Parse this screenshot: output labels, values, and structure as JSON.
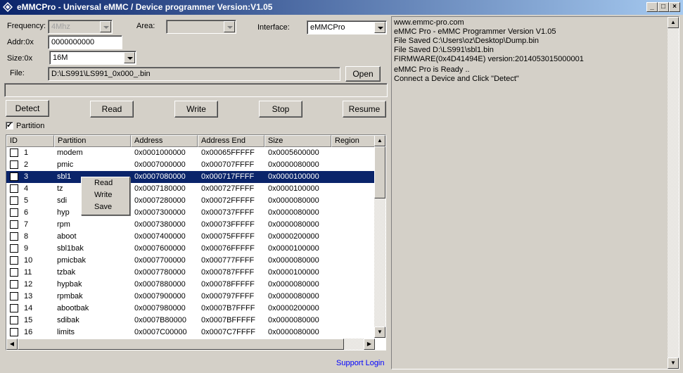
{
  "window": {
    "title": "eMMCPro - Universal eMMC / Device programmer  Version:V1.05"
  },
  "form": {
    "frequency_label": "Frequency:",
    "frequency_value": "4Mhz",
    "area_label": "Area:",
    "area_value": "",
    "interface_label": "Interface:",
    "interface_value": "eMMCPro",
    "addr_label": "Addr:0x",
    "addr_value": "0000000000",
    "size_label": "Size:0x",
    "size_value": "16M",
    "file_label": "File:",
    "file_value": "D:\\LS991\\LS991_0x000_.bin",
    "open_label": "Open"
  },
  "actions": {
    "detect": "Detect",
    "read": "Read",
    "write": "Write",
    "stop": "Stop",
    "resume": "Resume"
  },
  "partition_toggle": {
    "label": "Partition",
    "checked": true
  },
  "table": {
    "columns": [
      "ID",
      "Partition",
      "Address",
      "Address End",
      "Size",
      "Region"
    ],
    "rows": [
      {
        "id": "1",
        "name": "modem",
        "addr": "0x0001000000",
        "end": "0x00065FFFFF",
        "size": "0x0005600000"
      },
      {
        "id": "2",
        "name": "pmic",
        "addr": "0x0007000000",
        "end": "0x000707FFFF",
        "size": "0x0000080000"
      },
      {
        "id": "3",
        "name": "sbl1",
        "addr": "0x0007080000",
        "end": "0x000717FFFF",
        "size": "0x0000100000"
      },
      {
        "id": "4",
        "name": "tz",
        "addr": "0x0007180000",
        "end": "0x000727FFFF",
        "size": "0x0000100000"
      },
      {
        "id": "5",
        "name": "sdi",
        "addr": "0x0007280000",
        "end": "0x00072FFFFF",
        "size": "0x0000080000"
      },
      {
        "id": "6",
        "name": "hyp",
        "addr": "0x0007300000",
        "end": "0x000737FFFF",
        "size": "0x0000080000"
      },
      {
        "id": "7",
        "name": "rpm",
        "addr": "0x0007380000",
        "end": "0x00073FFFFF",
        "size": "0x0000080000"
      },
      {
        "id": "8",
        "name": "aboot",
        "addr": "0x0007400000",
        "end": "0x00075FFFFF",
        "size": "0x0000200000"
      },
      {
        "id": "9",
        "name": "sbl1bak",
        "addr": "0x0007600000",
        "end": "0x00076FFFFF",
        "size": "0x0000100000"
      },
      {
        "id": "10",
        "name": "pmicbak",
        "addr": "0x0007700000",
        "end": "0x000777FFFF",
        "size": "0x0000080000"
      },
      {
        "id": "11",
        "name": "tzbak",
        "addr": "0x0007780000",
        "end": "0x000787FFFF",
        "size": "0x0000100000"
      },
      {
        "id": "12",
        "name": "hypbak",
        "addr": "0x0007880000",
        "end": "0x00078FFFFF",
        "size": "0x0000080000"
      },
      {
        "id": "13",
        "name": "rpmbak",
        "addr": "0x0007900000",
        "end": "0x000797FFFF",
        "size": "0x0000080000"
      },
      {
        "id": "14",
        "name": "abootbak",
        "addr": "0x0007980000",
        "end": "0x0007B7FFFF",
        "size": "0x0000200000"
      },
      {
        "id": "15",
        "name": "sdibak",
        "addr": "0x0007B80000",
        "end": "0x0007BFFFFF",
        "size": "0x0000080000"
      },
      {
        "id": "16",
        "name": "limits",
        "addr": "0x0007C00000",
        "end": "0x0007C7FFFF",
        "size": "0x0000080000"
      }
    ],
    "selected_row": 2
  },
  "context_menu": [
    "Read",
    "Write",
    "Save"
  ],
  "log": [
    "www.emmc-pro.com",
    "eMMC Pro - eMMC Programmer Version V1.05",
    "File Saved C:\\Users\\oz\\Desktop\\Dump.bin",
    "File Saved D:\\LS991\\sbl1.bin",
    "FIRMWARE(0x4D41494E) version:2014053015000001",
    "eMMC Pro is Ready ..",
    "Connect a Device and Click \"Detect\""
  ],
  "support_link": "Support Login"
}
